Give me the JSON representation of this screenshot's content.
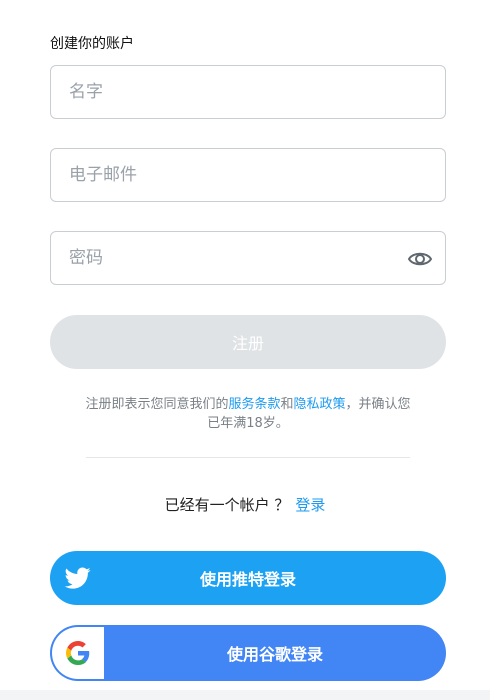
{
  "form": {
    "heading": "创建你的账户",
    "name_placeholder": "名字",
    "email_placeholder": "电子邮件",
    "password_placeholder": "密码",
    "register_label": "注册"
  },
  "terms": {
    "prefix": "注册即表示您同意我们的",
    "service_link": "服务条款",
    "and": "和",
    "privacy_link": "隐私政策",
    "suffix": "，并确认您已年满18岁。"
  },
  "signin": {
    "text": "已经有一个帐户 ？",
    "link": "登录"
  },
  "social": {
    "twitter_label": "使用推特登录",
    "google_label": "使用谷歌登录"
  },
  "colors": {
    "accent": "#1d9bf0",
    "twitter": "#1da1f2",
    "google": "#4285f4",
    "disabled": "#dfe3e6"
  },
  "icons": [
    "eye-icon",
    "twitter-icon",
    "google-icon"
  ]
}
